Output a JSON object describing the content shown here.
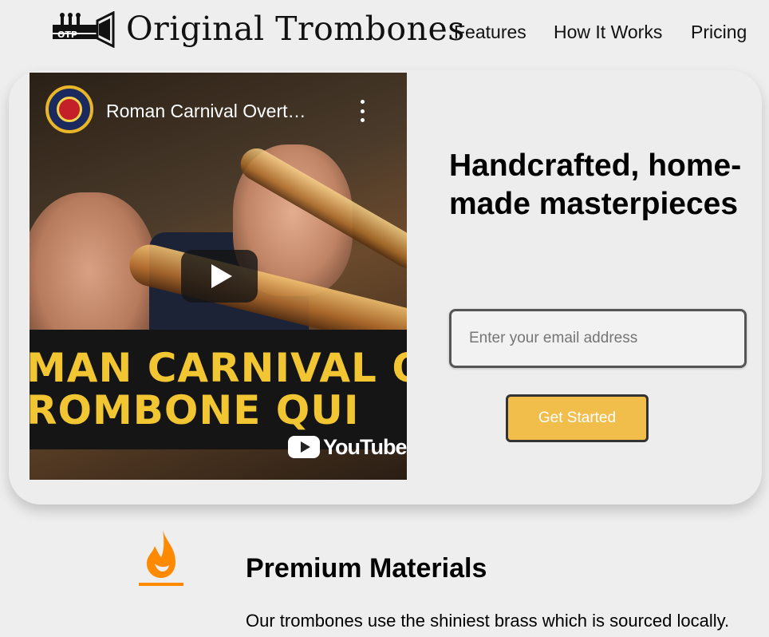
{
  "brand": {
    "name": "Original Trombones",
    "logo_letters": "OTP"
  },
  "nav": [
    {
      "label": "Features"
    },
    {
      "label": "How It Works"
    },
    {
      "label": "Pricing"
    }
  ],
  "video": {
    "title": "Roman Carnival Overt…",
    "overlay_line_1": "MAN CARNIVAL OVI",
    "overlay_line_2": "ROMBONE QUI",
    "platform": "YouTube"
  },
  "hero": {
    "headline": "Handcrafted, home-made masterpieces",
    "email_placeholder": "Enter your email address",
    "cta_label": "Get Started"
  },
  "feature": {
    "title": "Premium Materials",
    "description": "Our trombones use the shiniest brass which is sourced locally. This will increase the longevity of your purchase.",
    "icon": "fire-icon",
    "icon_color": "#ff8a00"
  },
  "colors": {
    "background": "#eeeeee",
    "cta": "#f1bd4b",
    "accent_yellow": "#f2c632"
  }
}
